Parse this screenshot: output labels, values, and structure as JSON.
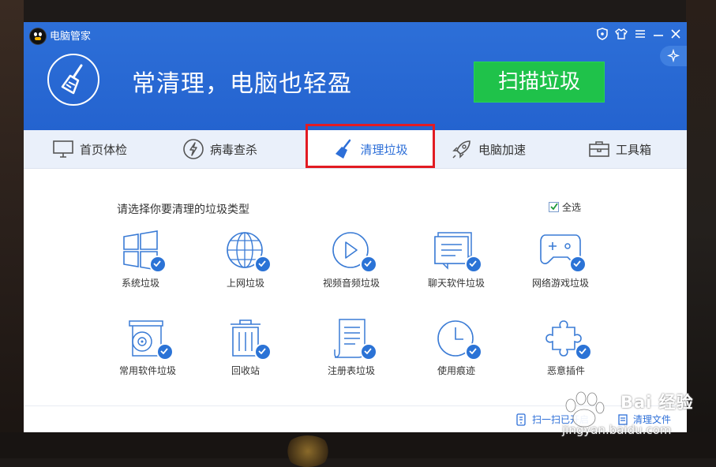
{
  "window": {
    "title": "电脑管家"
  },
  "header": {
    "slogan": "常清理，电脑也轻盈",
    "scan_button": "扫描垃圾"
  },
  "tabs": [
    {
      "label": "首页体检",
      "icon": "monitor-icon",
      "active": false
    },
    {
      "label": "病毒查杀",
      "icon": "lightning-icon",
      "active": false
    },
    {
      "label": "清理垃圾",
      "icon": "broom-icon",
      "active": true
    },
    {
      "label": "电脑加速",
      "icon": "rocket-icon",
      "active": false
    },
    {
      "label": "工具箱",
      "icon": "toolbox-icon",
      "active": false
    }
  ],
  "main": {
    "section_title": "请选择你要清理的垃圾类型",
    "select_all": {
      "label": "全选",
      "checked": true
    },
    "items": [
      {
        "label": "系统垃圾",
        "icon": "windows-icon",
        "checked": true
      },
      {
        "label": "上网垃圾",
        "icon": "globe-icon",
        "checked": true
      },
      {
        "label": "视频音频垃圾",
        "icon": "play-icon",
        "checked": true
      },
      {
        "label": "聊天软件垃圾",
        "icon": "chat-icon",
        "checked": true
      },
      {
        "label": "网络游戏垃圾",
        "icon": "gamepad-icon",
        "checked": true
      },
      {
        "label": "常用软件垃圾",
        "icon": "software-disc-icon",
        "checked": true
      },
      {
        "label": "回收站",
        "icon": "recycle-bin-icon",
        "checked": true
      },
      {
        "label": "注册表垃圾",
        "icon": "registry-document-icon",
        "checked": true
      },
      {
        "label": "使用痕迹",
        "icon": "clock-icon",
        "checked": true
      },
      {
        "label": "恶意插件",
        "icon": "puzzle-icon",
        "checked": true
      }
    ]
  },
  "footer": {
    "left_label": "扫一扫已开启",
    "right_label": "清理文件"
  },
  "watermark": {
    "text": "Bai 经验",
    "url": "jingyan.baidu.com"
  },
  "colors": {
    "header_blue": "#2463cf",
    "scan_green": "#1fc24a",
    "accent_blue": "#2d6fd8",
    "highlight_red": "#e21b22"
  }
}
